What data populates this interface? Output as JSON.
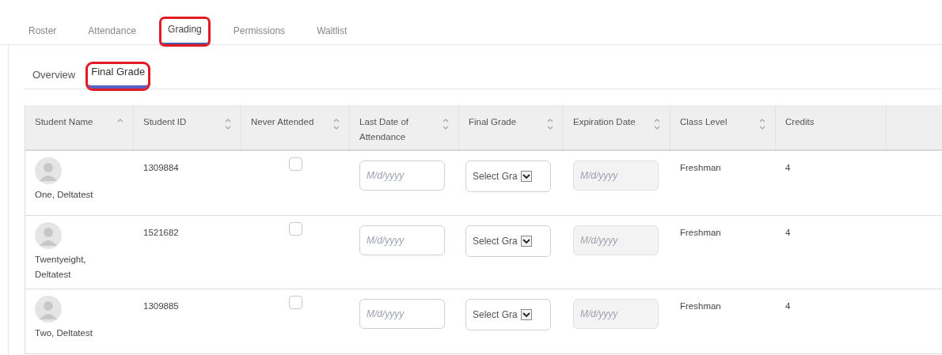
{
  "tabs": [
    {
      "label": "Roster",
      "selected": false,
      "highlighted": false
    },
    {
      "label": "Attendance",
      "selected": false,
      "highlighted": false
    },
    {
      "label": "Grading",
      "selected": true,
      "highlighted": true
    },
    {
      "label": "Permissions",
      "selected": false,
      "highlighted": false
    },
    {
      "label": "Waitlist",
      "selected": false,
      "highlighted": false
    }
  ],
  "subtabs": [
    {
      "label": "Overview",
      "selected": false,
      "highlighted": false
    },
    {
      "label": "Final Grade",
      "selected": true,
      "highlighted": true
    }
  ],
  "table": {
    "columns": [
      {
        "label": "Student Name",
        "sort_up": true,
        "sort_down": false
      },
      {
        "label": "Student ID",
        "sort_up": true,
        "sort_down": true
      },
      {
        "label": "Never Attended",
        "sort_up": true,
        "sort_down": true
      },
      {
        "label": "Last Date of Attendance",
        "sort_up": true,
        "sort_down": true
      },
      {
        "label": "Final Grade",
        "sort_up": true,
        "sort_down": true
      },
      {
        "label": "Expiration Date",
        "sort_up": true,
        "sort_down": true
      },
      {
        "label": "Class Level",
        "sort_up": true,
        "sort_down": true
      },
      {
        "label": "Credits",
        "sort_up": false,
        "sort_down": false
      }
    ],
    "rows": [
      {
        "name": "One, Deltatest",
        "id": "1309884",
        "never_attended": false,
        "last_date": {
          "placeholder": "M/d/yyyy",
          "disabled": false
        },
        "grade": "Select Gra",
        "expiration": {
          "placeholder": "M/d/yyyy",
          "disabled": true
        },
        "class_level": "Freshman",
        "credits": "4"
      },
      {
        "name": "Twentyeight, Deltatest",
        "id": "1521682",
        "never_attended": false,
        "last_date": {
          "placeholder": "M/d/yyyy",
          "disabled": false
        },
        "grade": "Select Gra",
        "expiration": {
          "placeholder": "M/d/yyyy",
          "disabled": true
        },
        "class_level": "Freshman",
        "credits": "4"
      },
      {
        "name": "Two, Deltatest",
        "id": "1309885",
        "never_attended": false,
        "last_date": {
          "placeholder": "M/d/yyyy",
          "disabled": false
        },
        "grade": "Select Gra",
        "expiration": {
          "placeholder": "M/d/yyyy",
          "disabled": true
        },
        "class_level": "Freshman",
        "credits": "4"
      }
    ]
  }
}
